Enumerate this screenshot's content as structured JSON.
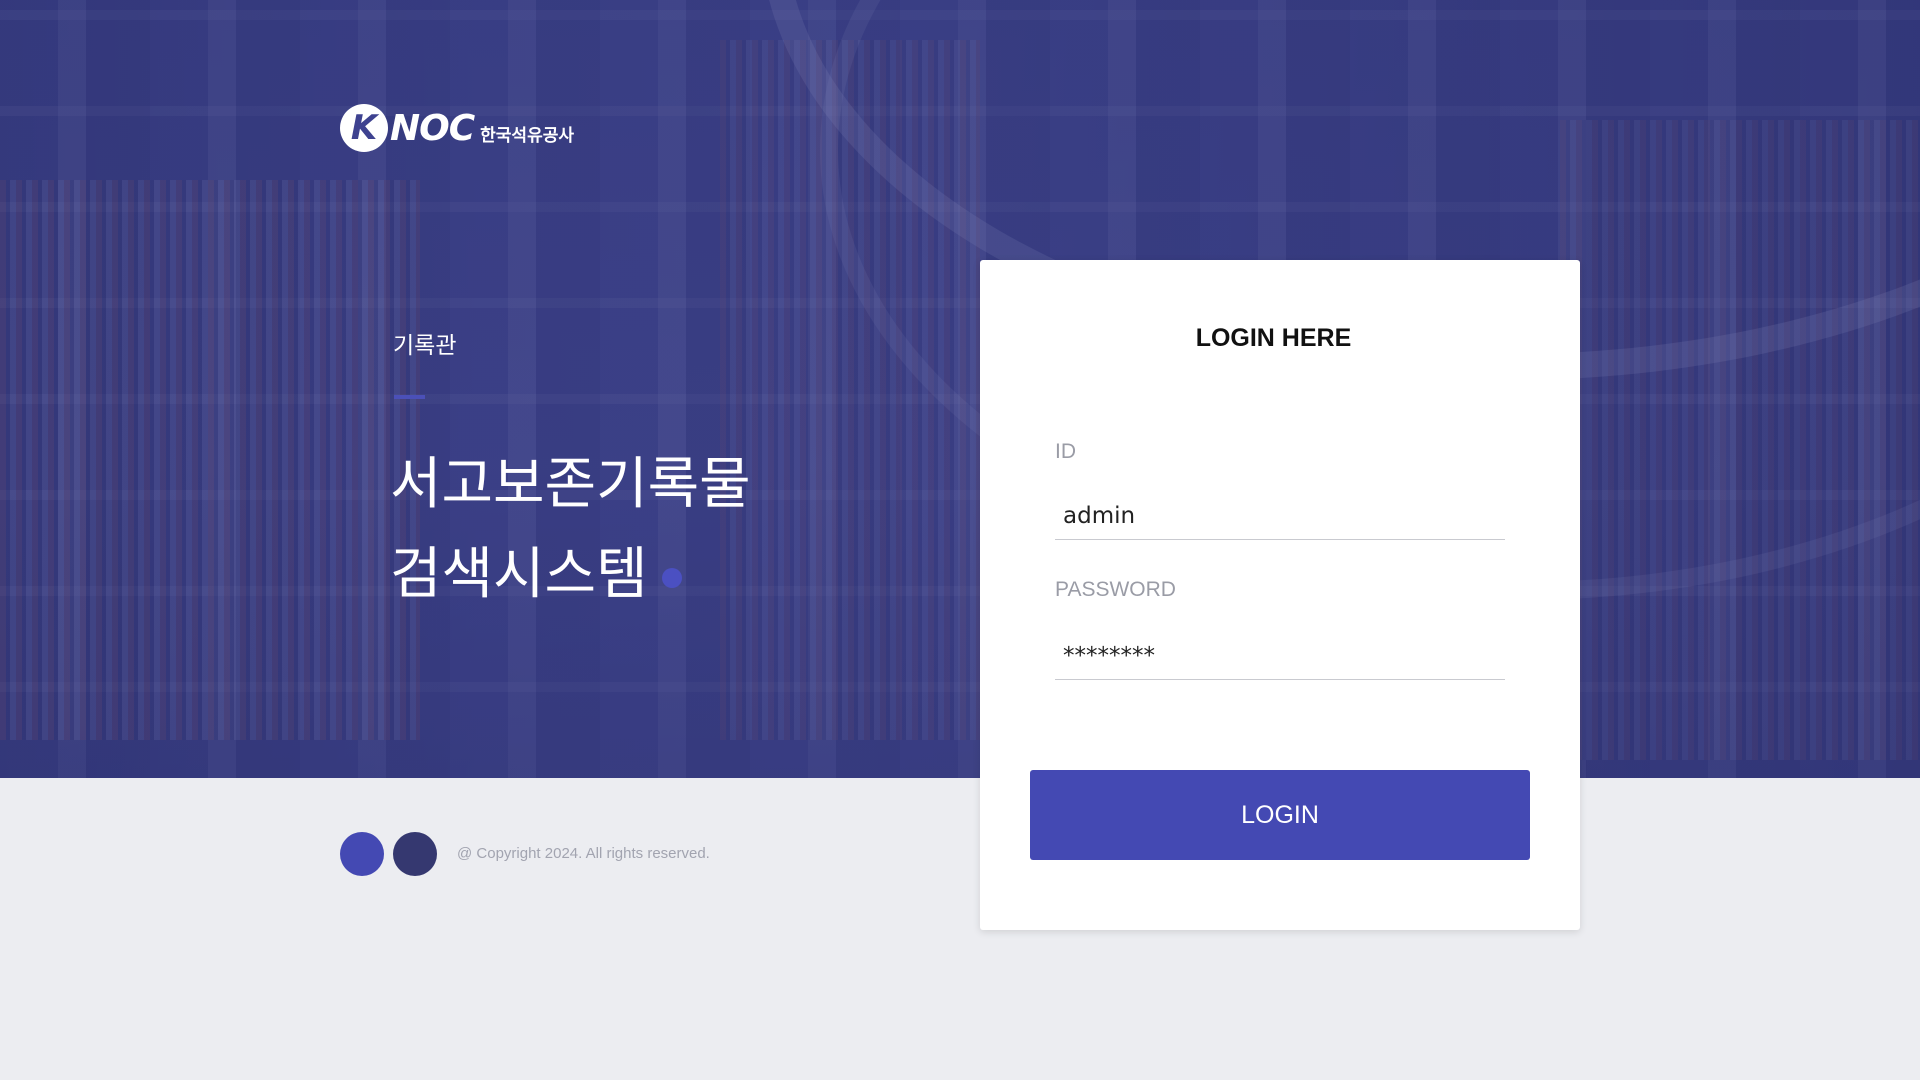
{
  "brand": {
    "logo_mark": "K",
    "logo_text": "NOC",
    "logo_korean": "한국석유공사"
  },
  "hero": {
    "subtitle": "기록관",
    "title_line1": "서고보존기록물",
    "title_line2": "검색시스템"
  },
  "login": {
    "heading": "LOGIN HERE",
    "id_label": "ID",
    "id_value": "admin",
    "password_label": "PASSWORD",
    "password_value": "********",
    "button_label": "LOGIN"
  },
  "footer": {
    "copyright": "@ Copyright 2024. All rights reserved."
  },
  "colors": {
    "accent": "#4449b3",
    "dark_accent": "#353870",
    "hero_overlay": "#3b3f86",
    "footer_bg": "#ecedf1"
  }
}
